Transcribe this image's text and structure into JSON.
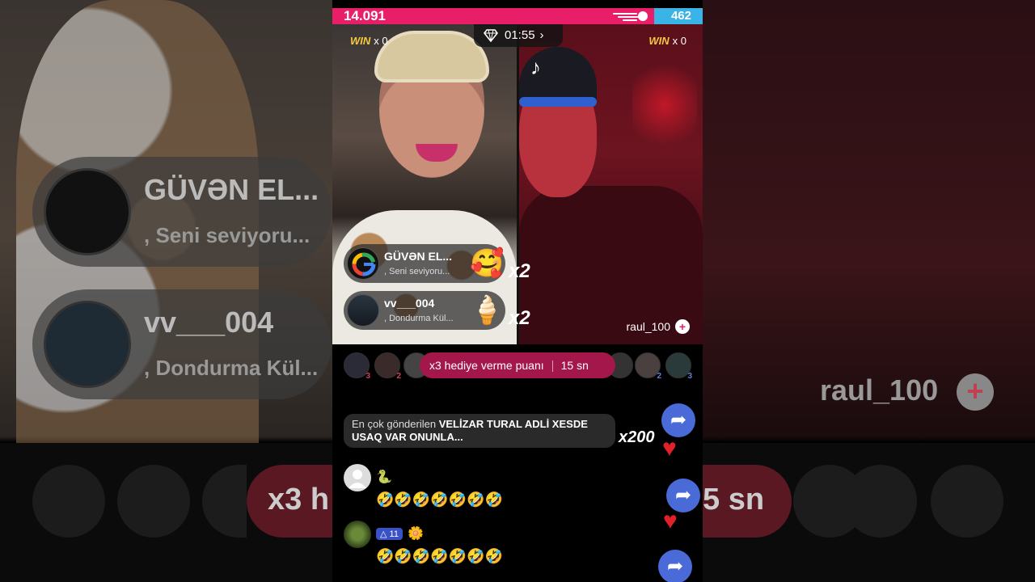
{
  "battle": {
    "score_left": "14.091",
    "score_right": "462",
    "timer": "01:55",
    "win_label": "WIN",
    "win_left": "x 0",
    "win_right": "x 0",
    "colors": {
      "left": "#e81e68",
      "right": "#3ab3e6"
    }
  },
  "gifts": [
    {
      "user": "GÜVƏN EL...",
      "message": ", Seni seviyoru...",
      "gift_icon": "heart-hug-emoji",
      "multiplier": "x2"
    },
    {
      "user": "vv___004",
      "message": ", Dondurma Kül...",
      "gift_icon": "ice-cream-emoji",
      "multiplier": "x2"
    }
  ],
  "opponent": {
    "name": "raul_100"
  },
  "bonus": {
    "text": "x3 hediye verme puanı",
    "time": "15 sn"
  },
  "top_sender": {
    "prefix": "En çok gönderilen",
    "line1_bold": "VELİZAR TURAL ADLİ XESDE",
    "line2_bold": "USAQ VAR ONUNLA...",
    "count": "x200"
  },
  "comments": [
    {
      "header": "🐍",
      "text": "🤣🤣🤣🤣🤣🤣🤣"
    },
    {
      "level": "11",
      "header": "🌼",
      "text": "🤣🤣🤣🤣🤣🤣🤣"
    }
  ],
  "background": {
    "gift1_user": "GÜVƏN EL...",
    "gift1_message": ", Seni seviyoru...",
    "gift2_user": "vv___004",
    "gift2_message": ", Dondurma Kül...",
    "opponent_name": "raul_100",
    "bonus_fragment": "x3 h",
    "time_fragment": "5 sn"
  }
}
